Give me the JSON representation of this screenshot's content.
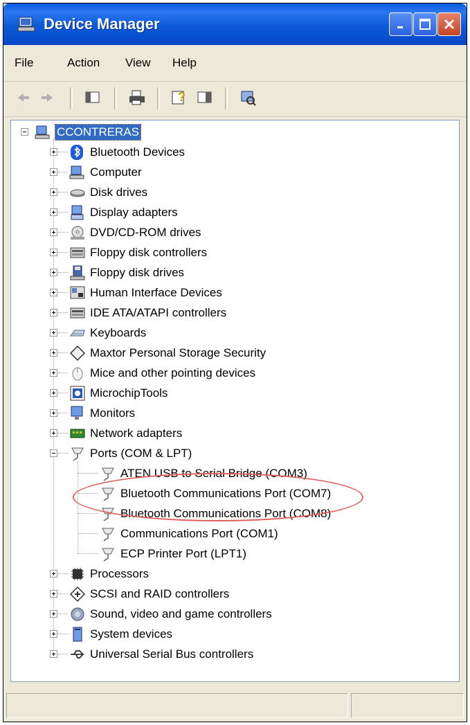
{
  "window": {
    "title": "Device Manager"
  },
  "menu": [
    "File",
    "Action",
    "View",
    "Help"
  ],
  "toolbar_icons": [
    "back-arrow-icon",
    "forward-arrow-icon",
    "properties-pane-icon",
    "print-icon",
    "help-icon",
    "action-pane-icon",
    "scan-hardware-icon"
  ],
  "tree": {
    "root": "CCONTRERAS",
    "categories": [
      {
        "label": "Bluetooth Devices",
        "icon": "bluetooth-icon"
      },
      {
        "label": "Computer",
        "icon": "computer-icon"
      },
      {
        "label": "Disk drives",
        "icon": "disk-drive-icon"
      },
      {
        "label": "Display adapters",
        "icon": "display-adapter-icon"
      },
      {
        "label": "DVD/CD-ROM drives",
        "icon": "dvd-drive-icon"
      },
      {
        "label": "Floppy disk controllers",
        "icon": "floppy-controller-icon"
      },
      {
        "label": "Floppy disk drives",
        "icon": "floppy-drive-icon"
      },
      {
        "label": "Human Interface Devices",
        "icon": "hid-icon"
      },
      {
        "label": "IDE ATA/ATAPI controllers",
        "icon": "ide-controller-icon"
      },
      {
        "label": "Keyboards",
        "icon": "keyboard-icon"
      },
      {
        "label": "Maxtor Personal Storage Security",
        "icon": "diamond-icon"
      },
      {
        "label": "Mice and other pointing devices",
        "icon": "mouse-icon"
      },
      {
        "label": "MicrochipTools",
        "icon": "microchip-icon"
      },
      {
        "label": "Monitors",
        "icon": "monitor-icon"
      },
      {
        "label": "Network adapters",
        "icon": "network-adapter-icon"
      },
      {
        "label": "Ports (COM & LPT)",
        "icon": "port-icon"
      },
      {
        "label": "Processors",
        "icon": "processor-icon"
      },
      {
        "label": "SCSI and RAID controllers",
        "icon": "scsi-icon"
      },
      {
        "label": "Sound, video and game controllers",
        "icon": "sound-icon"
      },
      {
        "label": "System devices",
        "icon": "system-devices-icon"
      },
      {
        "label": "Universal Serial Bus controllers",
        "icon": "usb-icon"
      }
    ],
    "ports": [
      "ATEN USB to Serial Bridge (COM3)",
      "Bluetooth Communications Port (COM7)",
      "Bluetooth Communications Port (COM8)",
      "Communications Port (COM1)",
      "ECP Printer Port (LPT1)"
    ]
  },
  "colors": {
    "titlebar": "#0a5ae0",
    "selection": "#316ac5",
    "annotation": "#e06060"
  }
}
